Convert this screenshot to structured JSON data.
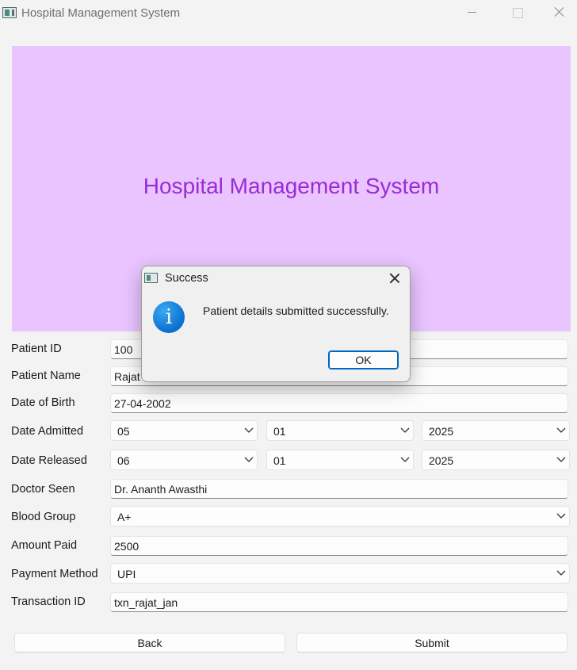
{
  "window": {
    "title": "Hospital Management System"
  },
  "banner": {
    "title": "Hospital Management System"
  },
  "form": {
    "patient_id": {
      "label": "Patient ID",
      "value": "100"
    },
    "patient_name": {
      "label": "Patient Name",
      "value": "Rajat"
    },
    "date_of_birth": {
      "label": "Date of Birth",
      "value": "27-04-2002"
    },
    "date_admitted": {
      "label": "Date Admitted",
      "day": "05",
      "month": "01",
      "year": "2025"
    },
    "date_released": {
      "label": "Date Released",
      "day": "06",
      "month": "01",
      "year": "2025"
    },
    "doctor_seen": {
      "label": "Doctor Seen",
      "value": "Dr. Ananth Awasthi"
    },
    "blood_group": {
      "label": "Blood Group",
      "value": "A+"
    },
    "amount_paid": {
      "label": "Amount Paid",
      "value": "2500"
    },
    "payment_method": {
      "label": "Payment Method",
      "value": "UPI"
    },
    "transaction_id": {
      "label": "Transaction ID",
      "value": "txn_rajat_jan"
    }
  },
  "buttons": {
    "back": "Back",
    "submit": "Submit"
  },
  "dialog": {
    "title": "Success",
    "message": "Patient details submitted successfully.",
    "ok": "OK",
    "icon": "information-icon",
    "icon_glyph": "i"
  },
  "colors": {
    "banner_bg": "#e9c4ff",
    "banner_text": "#9a2bd6",
    "accent": "#0067c0"
  }
}
